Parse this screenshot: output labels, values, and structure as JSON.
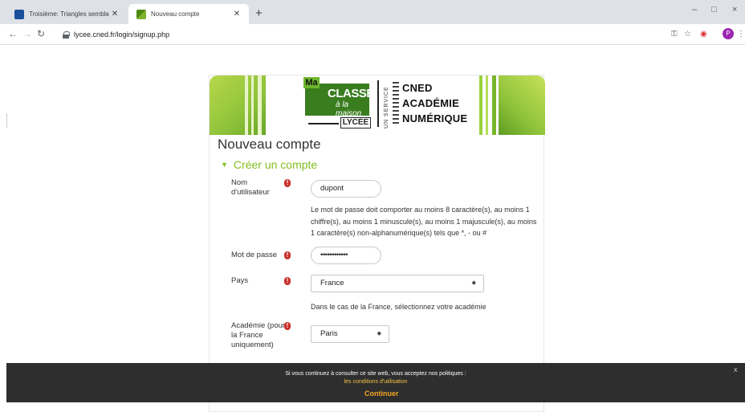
{
  "browser": {
    "tabs": [
      {
        "title": "Troisième: Triangles semblables",
        "active": false
      },
      {
        "title": "Nouveau compte",
        "active": true
      }
    ],
    "new_tab": "+",
    "url": "lycee.cned.fr/login/signup.php",
    "profile_initial": "P",
    "window_controls": {
      "minimize": "–",
      "maximize": "□",
      "close": "×"
    }
  },
  "logo": {
    "ma": "Ma",
    "classe": "CLASSE",
    "a_la_maison": "à la maison",
    "lycee": "LYCÉE",
    "un_service": "UN SERVICE",
    "cned_lines": [
      "CNED",
      "ACADÉMIE",
      "NUMÉRIQUE"
    ]
  },
  "form": {
    "title": "Nouveau compte",
    "section": "Créer un compte",
    "username": {
      "label_1": "Nom",
      "label_2": "d'utilisateur",
      "value": "dupont"
    },
    "password_help": [
      "Le mot de passe doit comporter au moins 8 caractère(s), au moins 1",
      "chiffre(s), au moins 1 minuscule(s), au moins 1 majuscule(s), au moins",
      "1 caractère(s) non-alphanumérique(s) tels que *, - ou #"
    ],
    "password": {
      "label": "Mot de passe",
      "value": "••••••••••••"
    },
    "country": {
      "label": "Pays",
      "value": "France"
    },
    "country_help": "Dans le cas de la France, sélectionnez votre académie",
    "academy": {
      "label_lines": [
        "Académie (pour",
        "la France",
        "uniquement)"
      ],
      "value": "Paris"
    },
    "required_icon": "!"
  },
  "cookie": {
    "message": "Si vous continuez à consulter ce site web, vous acceptez nos politiques :",
    "link": "les conditions d'utilisation",
    "button": "Continuer",
    "close": "x"
  },
  "colors": {
    "accent": "#84bd22",
    "required": "#c9302c",
    "cookie_button": "#f5a623"
  }
}
